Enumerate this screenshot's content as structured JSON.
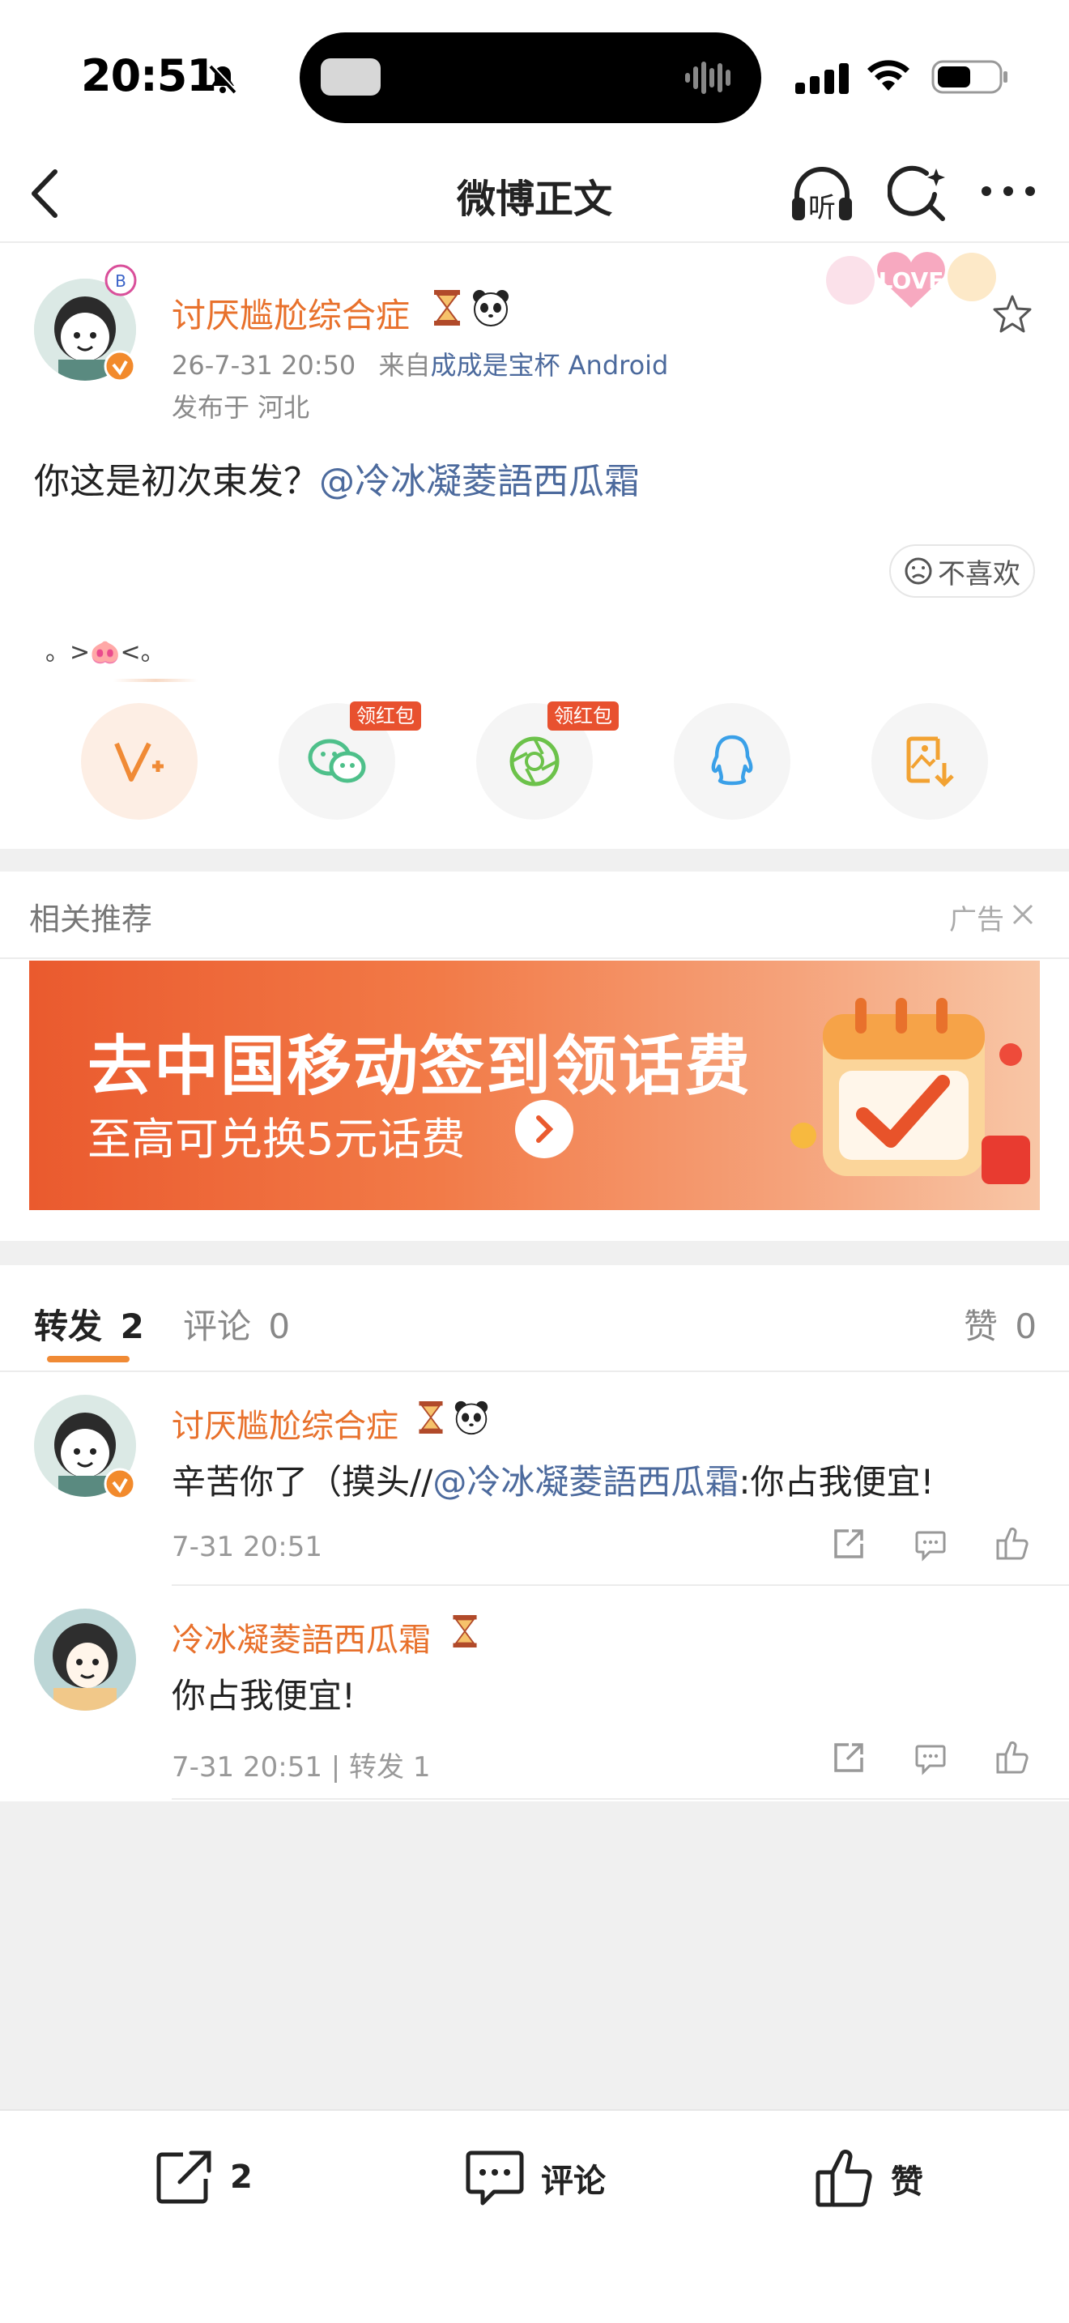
{
  "status_bar": {
    "time": "20:51"
  },
  "header": {
    "title": "微博正文",
    "listen_label": "听"
  },
  "post": {
    "author": "讨厌尴尬综合症",
    "timestamp": "26-7-31 20:50",
    "source_prefix": "来自",
    "source": "成成是宝杯 Android",
    "location": "发布于 河北",
    "text": "你这是初次束发？",
    "mention": "@冷冰凝菱語西瓜霜",
    "sticker_text": "LOVE",
    "dislike_label": "不喜欢",
    "emoticon_text": "。>🐽<。"
  },
  "share": {
    "badge_label": "领红包",
    "targets": [
      "weibo-super",
      "wechat",
      "moments",
      "qq",
      "save-image"
    ]
  },
  "recommend": {
    "section_label": "相关推荐",
    "ad_label": "广告",
    "ad_headline": "去中国移动签到领话费",
    "ad_sub": "至高可兑换5元话费"
  },
  "tabs": {
    "repost": "转发",
    "repost_count": "2",
    "comment": "评论",
    "comment_count": "0",
    "like": "赞",
    "like_count": "0"
  },
  "reposts": [
    {
      "user": "讨厌尴尬综合症",
      "text_prefix": "辛苦你了（摸头//",
      "mention": "@冷冰凝菱語西瓜霜",
      "text_suffix": ":你占我便宜!",
      "meta": "7-31 20:51"
    },
    {
      "user": "冷冰凝菱語西瓜霜",
      "text": "你占我便宜!",
      "meta": "7-31 20:51 | 转发 1"
    }
  ],
  "bottom_bar": {
    "repost_count": "2",
    "comment_label": "评论",
    "like_label": "赞"
  },
  "colors": {
    "accent": "#e8712c",
    "link": "#4c6a9d",
    "badge": "#e8512f",
    "tab_underline": "#f08a35"
  }
}
